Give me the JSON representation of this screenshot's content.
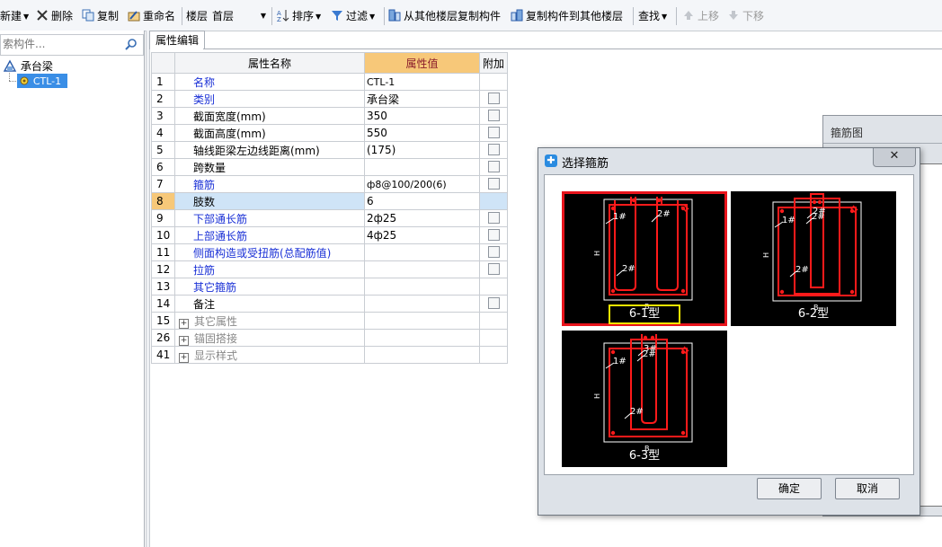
{
  "toolbar": {
    "new": "新建",
    "delete": "删除",
    "copy": "复制",
    "rename": "重命名",
    "floor_label": "楼层",
    "floor_value": "首层",
    "sort": "排序",
    "filter": "过滤",
    "copy_from_floor": "从其他楼层复制构件",
    "copy_to_floor": "复制构件到其他楼层",
    "find": "查找",
    "move_up": "上移",
    "move_down": "下移"
  },
  "left_panel": {
    "search_placeholder": "索构件...",
    "tree_root": "承台梁",
    "tree_child": "CTL-1"
  },
  "property_panel": {
    "tab": "属性编辑",
    "columns": [
      "属性名称",
      "属性值",
      "附加"
    ],
    "rows": [
      {
        "no": "1",
        "name": "名称",
        "value": "CTL-1"
      },
      {
        "no": "2",
        "name": "类别",
        "value": "承台梁"
      },
      {
        "no": "3",
        "name": "截面宽度(mm)",
        "value": "350"
      },
      {
        "no": "4",
        "name": "截面高度(mm)",
        "value": "550"
      },
      {
        "no": "5",
        "name": "轴线距梁左边线距离(mm)",
        "value": "(175)"
      },
      {
        "no": "6",
        "name": "跨数量",
        "value": ""
      },
      {
        "no": "7",
        "name": "箍筋",
        "value": "ф8@100/200(6)"
      },
      {
        "no": "8",
        "name": "肢数",
        "value": "6"
      },
      {
        "no": "9",
        "name": "下部通长筋",
        "value": "2ф25"
      },
      {
        "no": "10",
        "name": "上部通长筋",
        "value": "4ф25"
      },
      {
        "no": "11",
        "name": "侧面构造或受扭筋(总配筋值)",
        "value": ""
      },
      {
        "no": "12",
        "name": "拉筋",
        "value": ""
      },
      {
        "no": "13",
        "name": "其它箍筋",
        "value": ""
      },
      {
        "no": "14",
        "name": "备注",
        "value": ""
      },
      {
        "no": "15",
        "name": "其它属性",
        "value": ""
      },
      {
        "no": "26",
        "name": "锚固搭接",
        "value": ""
      },
      {
        "no": "41",
        "name": "显示样式",
        "value": ""
      }
    ]
  },
  "back_window": {
    "title": "箍筋图"
  },
  "dialog": {
    "title": "选择箍筋",
    "close": "✕",
    "options": [
      {
        "label": "6-1型",
        "selected": true
      },
      {
        "label": "6-2型",
        "selected": false
      },
      {
        "label": "6-3型",
        "selected": false
      }
    ],
    "marks": {
      "bar1": "1#",
      "bar2": "2#",
      "bar3": "3#",
      "width": "B",
      "height": "H"
    },
    "ok": "确定",
    "cancel": "取消"
  },
  "colors": {
    "selection_orange": "#f7c879",
    "selected_row_blue": "#cfe4f7",
    "rebar_red": "#ff1a1a",
    "selected_frame": "#e8141c",
    "label_highlight": "#f2e600"
  }
}
